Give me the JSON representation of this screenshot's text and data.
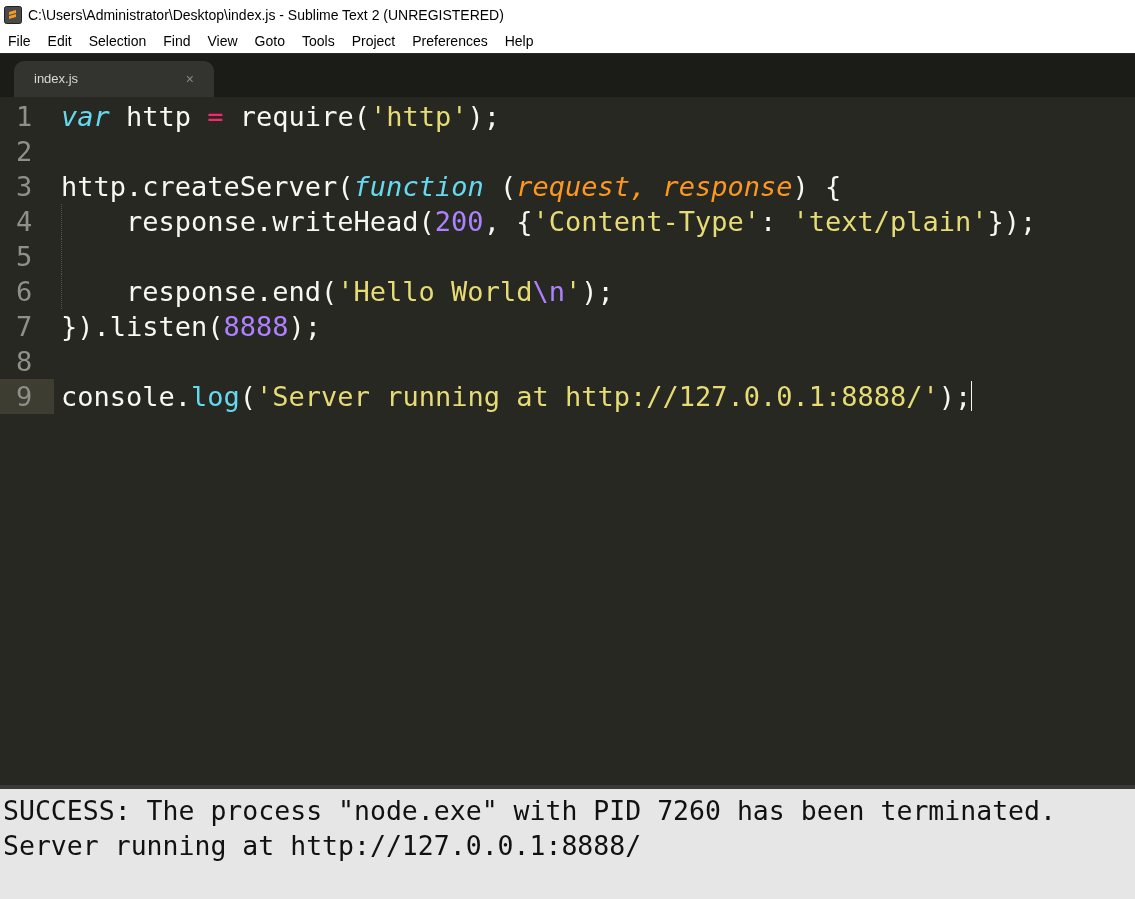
{
  "window": {
    "title": "C:\\Users\\Administrator\\Desktop\\index.js - Sublime Text 2 (UNREGISTERED)"
  },
  "menu": [
    "File",
    "Edit",
    "Selection",
    "Find",
    "View",
    "Goto",
    "Tools",
    "Project",
    "Preferences",
    "Help"
  ],
  "tabs": [
    {
      "label": "index.js",
      "close": "×",
      "selected": true
    }
  ],
  "editor": {
    "lines": [
      {
        "number": "1",
        "selected": false,
        "cursor": false,
        "indent": false,
        "tokens": [
          {
            "kind": "keyword",
            "text": "var"
          },
          {
            "kind": "plain",
            "text": " http "
          },
          {
            "kind": "operator",
            "text": "="
          },
          {
            "kind": "plain",
            "text": " require("
          },
          {
            "kind": "string",
            "text": "'http'"
          },
          {
            "kind": "plain",
            "text": ");"
          }
        ]
      },
      {
        "number": "2",
        "selected": false,
        "cursor": false,
        "indent": false
      },
      {
        "number": "3",
        "selected": false,
        "cursor": false,
        "indent": false,
        "tokens": [
          {
            "kind": "plain",
            "text": "http.createServer("
          },
          {
            "kind": "keyword",
            "text": "function"
          },
          {
            "kind": "plain",
            "text": " ("
          },
          {
            "kind": "param",
            "text": "request, response"
          },
          {
            "kind": "plain",
            "text": ") {"
          }
        ]
      },
      {
        "number": "4",
        "selected": false,
        "cursor": false,
        "indent": true,
        "tokens": [
          {
            "kind": "plain",
            "text": "response.writeHead("
          },
          {
            "kind": "number",
            "text": "200"
          },
          {
            "kind": "plain",
            "text": ", {"
          },
          {
            "kind": "string",
            "text": "'Content-Type'"
          },
          {
            "kind": "plain",
            "text": ": "
          },
          {
            "kind": "string",
            "text": "'text/plain'"
          },
          {
            "kind": "plain",
            "text": "});"
          }
        ]
      },
      {
        "number": "5",
        "selected": false,
        "cursor": false,
        "indent": true
      },
      {
        "number": "6",
        "selected": false,
        "cursor": false,
        "indent": true,
        "tokens": [
          {
            "kind": "plain",
            "text": "response.end("
          },
          {
            "kind": "string",
            "text": "'Hello World"
          },
          {
            "kind": "number",
            "text": "\\n"
          },
          {
            "kind": "string",
            "text": "'"
          },
          {
            "kind": "plain",
            "text": ");"
          }
        ]
      },
      {
        "number": "7",
        "selected": false,
        "cursor": false,
        "indent": false,
        "tokens": [
          {
            "kind": "plain",
            "text": "}).listen("
          },
          {
            "kind": "number",
            "text": "8888"
          },
          {
            "kind": "plain",
            "text": ");"
          }
        ]
      },
      {
        "number": "8",
        "selected": false,
        "cursor": false,
        "indent": false
      },
      {
        "number": "9",
        "selected": true,
        "cursor": true,
        "indent": false,
        "tokens": [
          {
            "kind": "plain",
            "text": "console."
          },
          {
            "kind": "support",
            "text": "log"
          },
          {
            "kind": "plain",
            "text": "("
          },
          {
            "kind": "string",
            "text": "'Server running at http://127.0.0.1:8888/'"
          },
          {
            "kind": "plain",
            "text": ");"
          }
        ]
      }
    ]
  },
  "console": {
    "lines": [
      "SUCCESS: The process \"node.exe\" with PID 7260 has been terminated.",
      "Server running at http://127.0.0.1:8888/"
    ]
  }
}
